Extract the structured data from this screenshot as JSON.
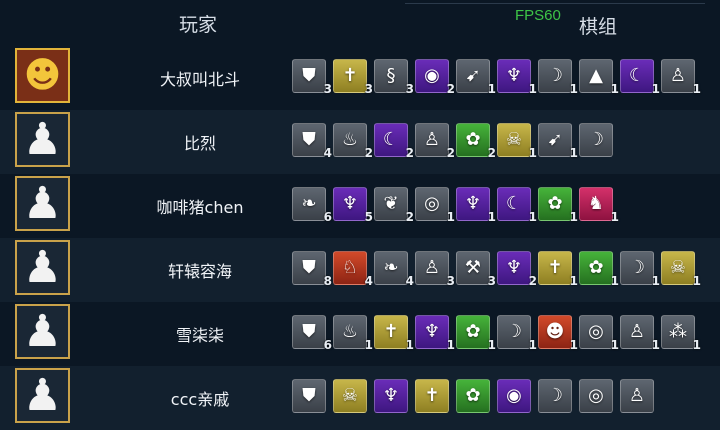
{
  "header": {
    "player_label": "玩家",
    "combo_label": "棋组",
    "fps": "FPS60"
  },
  "colors": {
    "gray": "#4b525b",
    "gold": "#ab9b36",
    "purple": "#54229c",
    "green": "#36922d",
    "red": "#b2381f",
    "pink": "#b02256"
  },
  "players": [
    {
      "name": "大叔叫北斗",
      "avatar": "golden-monster-avatar",
      "traits": [
        {
          "icon": "shield-icon",
          "color": "gray",
          "count": "3"
        },
        {
          "icon": "holy-cross-icon",
          "color": "gold",
          "count": "3"
        },
        {
          "icon": "spiral-icon",
          "color": "gray",
          "count": "3"
        },
        {
          "icon": "eye-icon",
          "color": "purple",
          "count": "2"
        },
        {
          "icon": "bow-icon",
          "color": "gray",
          "count": "1"
        },
        {
          "icon": "demon-wings-icon",
          "color": "purple",
          "count": "1"
        },
        {
          "icon": "scythe-icon",
          "color": "gray",
          "count": "1"
        },
        {
          "icon": "goblin-hat-icon",
          "color": "gray",
          "count": "1"
        },
        {
          "icon": "crescent-icon",
          "color": "purple",
          "count": "1"
        },
        {
          "icon": "human-icon",
          "color": "gray",
          "count": "1"
        }
      ]
    },
    {
      "name": "比烈",
      "avatar": "pawn-avatar",
      "traits": [
        {
          "icon": "shield-icon",
          "color": "gray",
          "count": "4"
        },
        {
          "icon": "flame-icon",
          "color": "gray",
          "count": "2"
        },
        {
          "icon": "crescent-icon",
          "color": "purple",
          "count": "2"
        },
        {
          "icon": "human-icon",
          "color": "gray",
          "count": "2"
        },
        {
          "icon": "beast-paw-icon",
          "color": "green",
          "count": "2"
        },
        {
          "icon": "skull-mask-icon",
          "color": "gold",
          "count": "1"
        },
        {
          "icon": "bow-icon",
          "color": "gray",
          "count": "1"
        },
        {
          "icon": "scythe-icon",
          "color": "gray",
          "count": ""
        }
      ]
    },
    {
      "name": "咖啡猪chen",
      "avatar": "pawn-avatar",
      "traits": [
        {
          "icon": "elf-ear-icon",
          "color": "gray",
          "count": "6"
        },
        {
          "icon": "demon-wings-icon",
          "color": "purple",
          "count": "5"
        },
        {
          "icon": "leaf-icon",
          "color": "gray",
          "count": "2"
        },
        {
          "icon": "target-eye-icon",
          "color": "gray",
          "count": "1"
        },
        {
          "icon": "demon-wings-icon",
          "color": "purple",
          "count": "1"
        },
        {
          "icon": "crescent-icon",
          "color": "purple",
          "count": "1"
        },
        {
          "icon": "beast-paw-icon",
          "color": "green",
          "count": "1"
        },
        {
          "icon": "dragon-icon",
          "color": "pink",
          "count": "1"
        }
      ]
    },
    {
      "name": "轩辕容海",
      "avatar": "pawn-avatar",
      "traits": [
        {
          "icon": "shield-icon",
          "color": "gray",
          "count": "8"
        },
        {
          "icon": "wolf-icon",
          "color": "red",
          "count": "4"
        },
        {
          "icon": "elf-ear-icon",
          "color": "gray",
          "count": "4"
        },
        {
          "icon": "human-icon",
          "color": "gray",
          "count": "3"
        },
        {
          "icon": "hammer-icon",
          "color": "gray",
          "count": "3"
        },
        {
          "icon": "demon-wings-icon",
          "color": "purple",
          "count": "2"
        },
        {
          "icon": "holy-cross-icon",
          "color": "gold",
          "count": "1"
        },
        {
          "icon": "beast-paw-icon",
          "color": "green",
          "count": "1"
        },
        {
          "icon": "scythe-icon",
          "color": "gray",
          "count": "1"
        },
        {
          "icon": "skull-mask-icon",
          "color": "gold",
          "count": "1"
        }
      ]
    },
    {
      "name": "雪柒柒",
      "avatar": "pawn-avatar",
      "traits": [
        {
          "icon": "shield-icon",
          "color": "gray",
          "count": "6"
        },
        {
          "icon": "flame-icon",
          "color": "gray",
          "count": "1"
        },
        {
          "icon": "holy-cross-icon",
          "color": "gold",
          "count": "1"
        },
        {
          "icon": "demon-wings-icon",
          "color": "purple",
          "count": "1"
        },
        {
          "icon": "beast-paw-icon",
          "color": "green",
          "count": "1"
        },
        {
          "icon": "scythe-icon",
          "color": "gray",
          "count": "1"
        },
        {
          "icon": "troll-face-icon",
          "color": "red",
          "count": "1"
        },
        {
          "icon": "target-eye-icon",
          "color": "gray",
          "count": "1"
        },
        {
          "icon": "human-icon",
          "color": "gray",
          "count": "1"
        },
        {
          "icon": "molecule-icon",
          "color": "gray",
          "count": "1"
        }
      ]
    },
    {
      "name": "ccc亲戚",
      "avatar": "pawn-avatar",
      "traits": [
        {
          "icon": "shield-icon",
          "color": "gray",
          "count": ""
        },
        {
          "icon": "skull-mask-icon",
          "color": "gold",
          "count": ""
        },
        {
          "icon": "demon-wings-icon",
          "color": "purple",
          "count": ""
        },
        {
          "icon": "holy-cross-icon",
          "color": "gold",
          "count": ""
        },
        {
          "icon": "beast-paw-icon",
          "color": "green",
          "count": ""
        },
        {
          "icon": "eye-icon",
          "color": "purple",
          "count": ""
        },
        {
          "icon": "scythe-icon",
          "color": "gray",
          "count": ""
        },
        {
          "icon": "target-eye-icon",
          "color": "gray",
          "count": ""
        },
        {
          "icon": "human-icon",
          "color": "gray",
          "count": ""
        }
      ]
    }
  ]
}
